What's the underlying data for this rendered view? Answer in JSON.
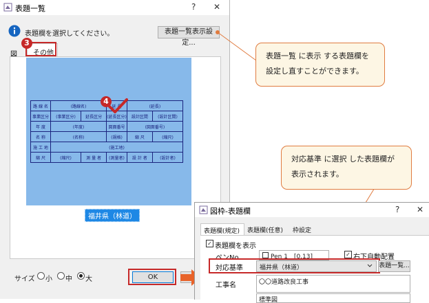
{
  "main_dialog": {
    "title": "表題一覧",
    "help": "?",
    "close": "✕",
    "instruction": "表題欄を選択してください。",
    "list_button": "表題一覧表示設定...",
    "tabs": [
      "図",
      "その他"
    ],
    "step3": "3",
    "step4": "4",
    "selected_caption": "福井県（林道）",
    "size_label": "サイズ",
    "size_options": [
      "小",
      "中",
      "大"
    ],
    "size_selected": "大",
    "ok_label": "OK",
    "form_rows": [
      [
        "路 線 名",
        "(路線名)",
        "延 長",
        "(延長)"
      ],
      [
        "事業区分",
        "(事業区分)",
        "延長区分",
        "(延長区分)",
        "設計区間",
        "(設計区間)"
      ],
      [
        "年 度",
        "(年度)",
        "図面番号",
        "(図面番号)"
      ],
      [
        "名 称",
        "(名称)",
        "(規格)",
        "縮 尺",
        "(縮尺)"
      ],
      [
        "施 工 地",
        "(施工地)"
      ],
      [
        "縮 尺",
        "(縮尺)",
        "測 量 者",
        "(測量者)",
        "設 計 者",
        "(設計者)"
      ]
    ]
  },
  "callouts": {
    "top": [
      "表題一覧 に表示 する表題欄を",
      "設定し直すことができます。"
    ],
    "bottom": [
      "対応基準 に選択 した表題欄が",
      "表示されます。"
    ]
  },
  "sub_dialog": {
    "title": "図枠-表題欄",
    "help": "?",
    "close": "✕",
    "tabs": [
      "表題欄(規定)",
      "表題欄(任意)",
      "枠設定"
    ],
    "show_title_label": "表題欄を表示",
    "pen_label": "ペンNo",
    "pen_value": "Pen 1　[0.13]",
    "auto_place_label": "右下自動配置",
    "standard_label": "対応基準",
    "standard_value": "福井県（林道）",
    "list_button": "表題一覧...",
    "work_name_label": "工事名",
    "work_name_value": "〇〇道路改良工事",
    "next_value": "標準図"
  },
  "colors": {
    "accent": "#c62828",
    "callout_border": "#e07b3f",
    "callout_bg": "#fdf6e4",
    "preview_bg": "#87b9ea",
    "form_line": "#1a237e",
    "arrow": "#e8632a"
  }
}
